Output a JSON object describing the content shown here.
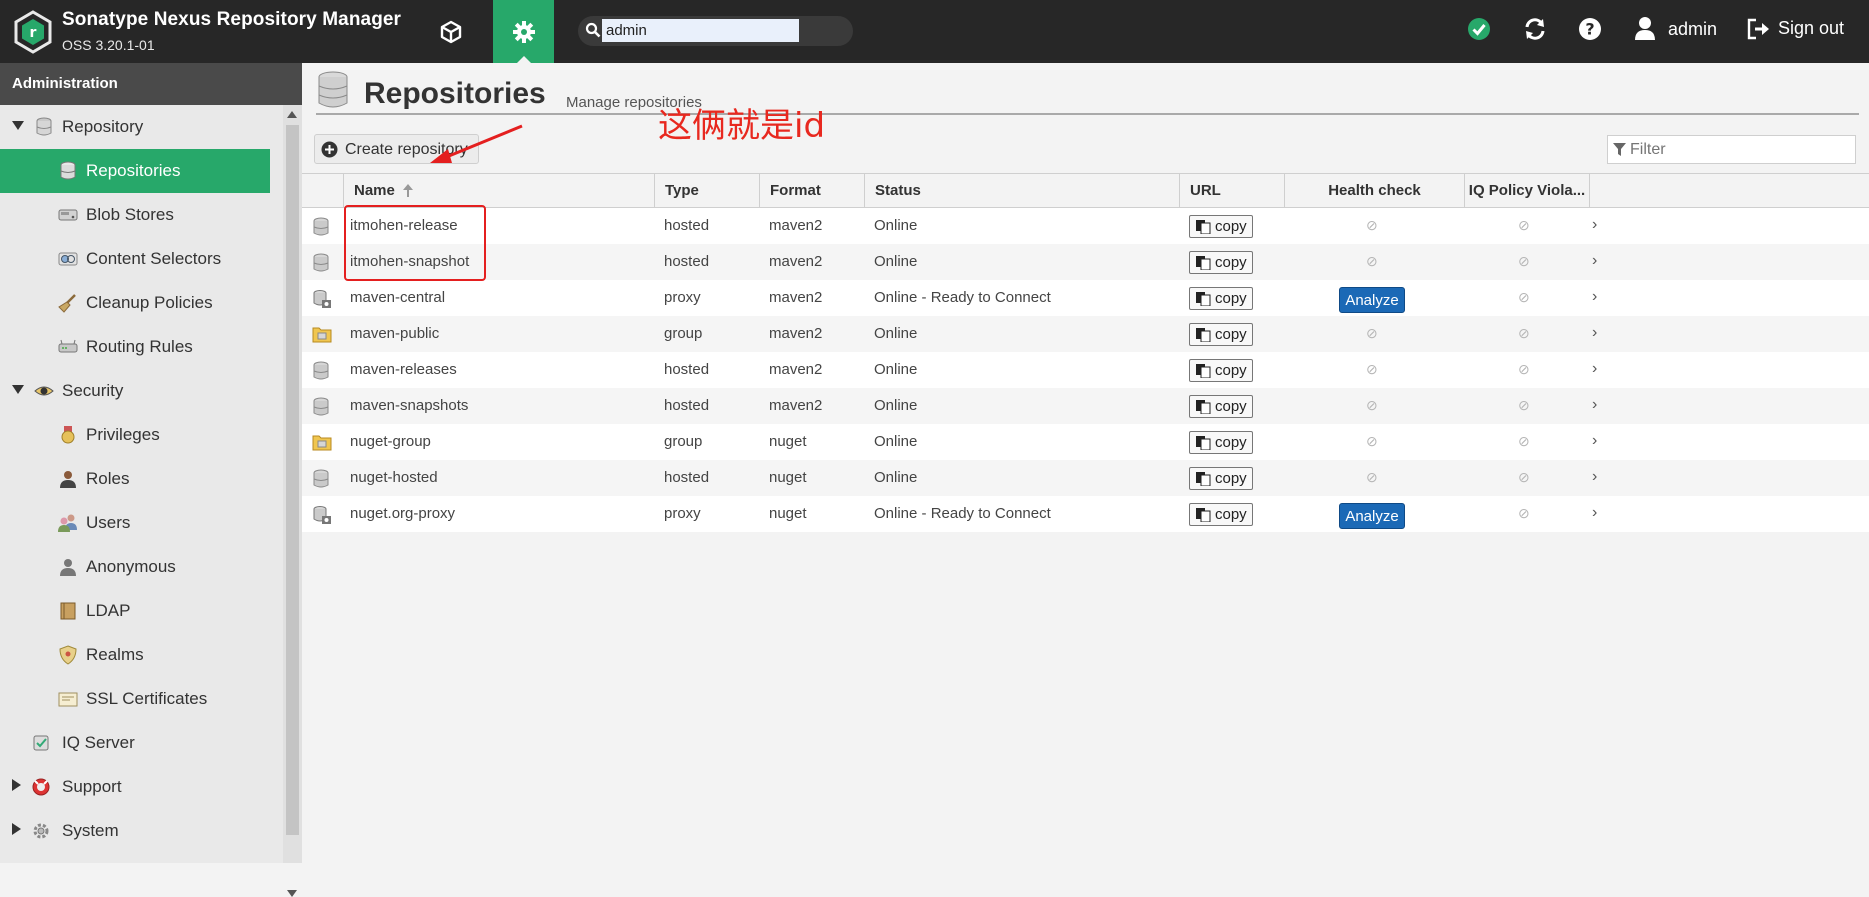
{
  "header": {
    "app_title": "Sonatype Nexus Repository Manager",
    "app_version": "OSS 3.20.1-01",
    "search_value": "admin",
    "user": "admin",
    "signout": "Sign out",
    "status_color": "#27a86a"
  },
  "sidebar": {
    "title": "Administration",
    "items": [
      {
        "label": "Repository",
        "icon": "database-icon",
        "level": 0,
        "expanded": true
      },
      {
        "label": "Repositories",
        "icon": "database-icon",
        "level": 1,
        "selected": true
      },
      {
        "label": "Blob Stores",
        "icon": "drive-icon",
        "level": 1
      },
      {
        "label": "Content Selectors",
        "icon": "selector-icon",
        "level": 1
      },
      {
        "label": "Cleanup Policies",
        "icon": "broom-icon",
        "level": 1
      },
      {
        "label": "Routing Rules",
        "icon": "router-icon",
        "level": 1
      },
      {
        "label": "Security",
        "icon": "eye-icon",
        "level": 0,
        "expanded": true
      },
      {
        "label": "Privileges",
        "icon": "medal-icon",
        "level": 1
      },
      {
        "label": "Roles",
        "icon": "role-icon",
        "level": 1
      },
      {
        "label": "Users",
        "icon": "users-icon",
        "level": 1
      },
      {
        "label": "Anonymous",
        "icon": "user-icon",
        "level": 1
      },
      {
        "label": "LDAP",
        "icon": "book-icon",
        "level": 1
      },
      {
        "label": "Realms",
        "icon": "shield-icon",
        "level": 1
      },
      {
        "label": "SSL Certificates",
        "icon": "certificate-icon",
        "level": 1
      },
      {
        "label": "IQ Server",
        "icon": "iq-icon",
        "level": 0
      },
      {
        "label": "Support",
        "icon": "lifebuoy-icon",
        "level": 0,
        "expanded": false
      },
      {
        "label": "System",
        "icon": "gear-icon",
        "level": 0,
        "expanded": false
      }
    ]
  },
  "page": {
    "title": "Repositories",
    "subtitle": "Manage repositories",
    "create_label": "Create repository",
    "filter_placeholder": "Filter",
    "annotation": "这俩就是id"
  },
  "grid": {
    "columns": [
      "Name",
      "Type",
      "Format",
      "Status",
      "URL",
      "Health check",
      "IQ Policy Viola..."
    ],
    "copy_label": "copy",
    "analyze_label": "Analyze",
    "rows": [
      {
        "name": "itmohen-release",
        "type": "hosted",
        "format": "maven2",
        "status": "Online",
        "health": "none",
        "icon": "hosted-icon"
      },
      {
        "name": "itmohen-snapshot",
        "type": "hosted",
        "format": "maven2",
        "status": "Online",
        "health": "none",
        "icon": "hosted-icon"
      },
      {
        "name": "maven-central",
        "type": "proxy",
        "format": "maven2",
        "status": "Online - Ready to Connect",
        "health": "analyze",
        "icon": "proxy-icon"
      },
      {
        "name": "maven-public",
        "type": "group",
        "format": "maven2",
        "status": "Online",
        "health": "none",
        "icon": "group-icon"
      },
      {
        "name": "maven-releases",
        "type": "hosted",
        "format": "maven2",
        "status": "Online",
        "health": "none",
        "icon": "hosted-icon"
      },
      {
        "name": "maven-snapshots",
        "type": "hosted",
        "format": "maven2",
        "status": "Online",
        "health": "none",
        "icon": "hosted-icon"
      },
      {
        "name": "nuget-group",
        "type": "group",
        "format": "nuget",
        "status": "Online",
        "health": "none",
        "icon": "group-icon"
      },
      {
        "name": "nuget-hosted",
        "type": "hosted",
        "format": "nuget",
        "status": "Online",
        "health": "none",
        "icon": "hosted-icon"
      },
      {
        "name": "nuget.org-proxy",
        "type": "proxy",
        "format": "nuget",
        "status": "Online - Ready to Connect",
        "health": "analyze",
        "icon": "proxy-icon"
      }
    ]
  }
}
